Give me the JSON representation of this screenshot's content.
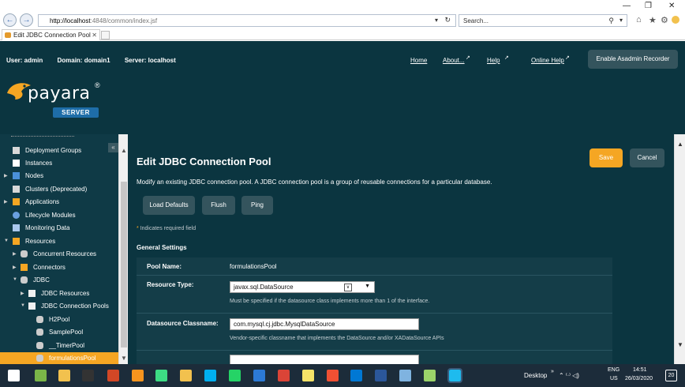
{
  "browser": {
    "url_host": "http://localhost",
    "url_path": ":4848/common/index.jsf",
    "search_placeholder": "Search...",
    "tab_title": "Edit JDBC Connection Pool",
    "tab_close": "✕",
    "back_glyph": "←",
    "forward_glyph": "→",
    "search_glyph": "⚲",
    "home_glyph": "⌂",
    "star_glyph": "★",
    "settings_glyph": "⚙",
    "minimize_glyph": "—",
    "restore_glyph": "❐",
    "close_glyph": "✕"
  },
  "header": {
    "user": "User: admin",
    "domain": "Domain: domain1",
    "server": "Server: localhost",
    "links": {
      "home": "Home",
      "about": "About...",
      "help": "Help",
      "online_help": "Online Help"
    },
    "recorder_label": "Enable Asadmin Recorder",
    "logo_text": "payara",
    "logo_mark": "®",
    "logo_badge": "SERVER"
  },
  "sidebar": {
    "collapse_glyph": "«",
    "items": [
      {
        "label": "Deployment Groups",
        "icon": "group-icon",
        "color": "#d8d8d8"
      },
      {
        "label": "Instances",
        "icon": "instance-icon",
        "color": "#ffffff"
      },
      {
        "label": "Nodes",
        "icon": "node-icon",
        "color": "#4a90d9"
      },
      {
        "label": "Clusters (Deprecated)",
        "icon": "cluster-icon",
        "color": "#d8d8d8"
      },
      {
        "label": "Applications",
        "icon": "application-icon",
        "color": "#f5a623"
      },
      {
        "label": "Lifecycle Modules",
        "icon": "lifecycle-icon",
        "color": "#6aa0e0"
      },
      {
        "label": "Monitoring Data",
        "icon": "monitor-icon",
        "color": "#aac8ee"
      },
      {
        "label": "Resources",
        "icon": "folder-icon",
        "color": "#f5a623"
      },
      {
        "label": "Concurrent Resources",
        "icon": "database-icon",
        "color": "#cccccc"
      },
      {
        "label": "Connectors",
        "icon": "connector-icon",
        "color": "#f5a623"
      },
      {
        "label": "JDBC",
        "icon": "database-icon",
        "color": "#cccccc"
      },
      {
        "label": "JDBC Resources",
        "icon": "folder-icon",
        "color": "#f0f0f0"
      },
      {
        "label": "JDBC Connection Pools",
        "icon": "folder-icon",
        "color": "#f0f0f0"
      },
      {
        "label": "H2Pool",
        "icon": "database-icon",
        "color": "#cccccc"
      },
      {
        "label": "SamplePool",
        "icon": "database-icon",
        "color": "#cccccc"
      },
      {
        "label": "__TimerPool",
        "icon": "database-icon",
        "color": "#cccccc"
      },
      {
        "label": "formulationsPool",
        "icon": "database-icon",
        "color": "#cccccc"
      }
    ]
  },
  "main": {
    "title": "Edit JDBC Connection Pool",
    "description": "Modify an existing JDBC connection pool. A JDBC connection pool is a group of reusable connections for a particular database.",
    "buttons": {
      "save": "Save",
      "cancel": "Cancel",
      "load_defaults": "Load Defaults",
      "flush": "Flush",
      "ping": "Ping"
    },
    "required_star": "*",
    "required_note": "Indicates required field",
    "section_title": "General Settings",
    "fields": {
      "pool_name_label": "Pool Name:",
      "pool_name_value": "formulationsPool",
      "resource_type_label": "Resource Type:",
      "resource_type_value": "javax.sql.DataSource",
      "resource_type_help": "Must be specified if the datasource class implements more than 1 of the interface.",
      "ds_classname_label": "Datasource Classname:",
      "ds_classname_value": "com.mysql.cj.jdbc.MysqlDataSource",
      "ds_classname_help": "Vendor-specific classname that implements the DataSource and/or XADataSource APIs"
    }
  },
  "taskbar": {
    "desktop": "Desktop",
    "lang_top": "ENG",
    "lang_bottom": "US",
    "time": "14:51",
    "date": "26/03/2020",
    "notifications": "20",
    "tray": "⌃ ⁽ᐧ⁾ ◁)",
    "icons": [
      {
        "name": "windows-start-icon",
        "color": "#ffffff"
      },
      {
        "name": "app-v-icon",
        "color": "#7ab648"
      },
      {
        "name": "file-explorer-icon",
        "color": "#f2c14e"
      },
      {
        "name": "terminal-icon",
        "color": "#333333"
      },
      {
        "name": "powerpoint-icon",
        "color": "#d24726"
      },
      {
        "name": "eclipse-icon",
        "color": "#f7941e"
      },
      {
        "name": "android-icon",
        "color": "#3ddc84"
      },
      {
        "name": "folder-icon",
        "color": "#f2c14e"
      },
      {
        "name": "skype-icon",
        "color": "#00aff0"
      },
      {
        "name": "whatsapp-icon",
        "color": "#25d366"
      },
      {
        "name": "vs-code-icon",
        "color": "#2c7ad6"
      },
      {
        "name": "chrome-icon",
        "color": "#db4437"
      },
      {
        "name": "sticky-notes-icon",
        "color": "#f7e368"
      },
      {
        "name": "git-icon",
        "color": "#f05033"
      },
      {
        "name": "outlook-icon",
        "color": "#0078d4"
      },
      {
        "name": "word-icon",
        "color": "#2b579a"
      },
      {
        "name": "network-icon",
        "color": "#7fb3e0"
      },
      {
        "name": "notepad-icon",
        "color": "#9bd36a"
      },
      {
        "name": "internet-explorer-icon",
        "color": "#1ebbee"
      }
    ]
  }
}
